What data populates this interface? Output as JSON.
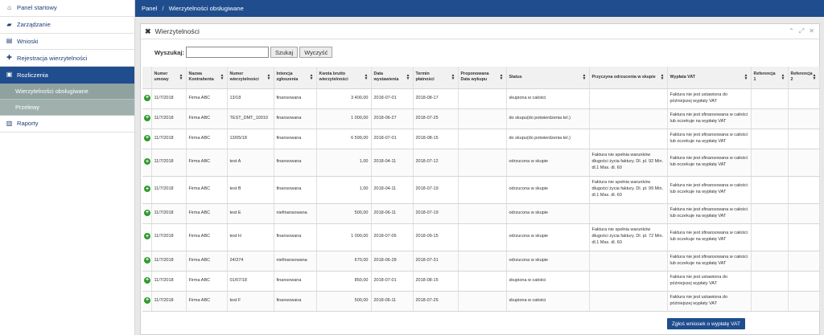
{
  "sidebar": {
    "items": [
      {
        "label": "Panel startowy",
        "icon": "home-icon",
        "glyph": "⌂"
      },
      {
        "label": "Zarządzanie",
        "icon": "briefcase-icon",
        "glyph": "▰"
      },
      {
        "label": "Wnioski",
        "icon": "document-icon",
        "glyph": "▤"
      },
      {
        "label": "Rejestracja wierzytelności",
        "icon": "plus-icon",
        "glyph": "✚"
      },
      {
        "label": "Rozliczenia",
        "icon": "money-icon",
        "glyph": "▣"
      },
      {
        "label": "Raporty",
        "icon": "bar-chart-icon",
        "glyph": "▥"
      }
    ],
    "sub_items": [
      {
        "label": "Wierzytelności obsługiwane"
      },
      {
        "label": "Przelewy"
      }
    ]
  },
  "breadcrumb": {
    "home": "Panel",
    "separator": "/",
    "current": "Wierzytelności obsługiwane"
  },
  "panel": {
    "title": "Wierzytelności",
    "close_glyph": "✖",
    "tool_glyphs": [
      "⌃",
      "⤢",
      "✕"
    ]
  },
  "search": {
    "label": "Wyszukaj:",
    "value": "",
    "search_button": "Szukaj",
    "clear_button": "Wyczyść"
  },
  "table": {
    "headers": [
      "Numer umowy",
      "Nazwa Kontrahenta",
      "Numer wierzytelności",
      "Intencja zgłoszenia",
      "Kwota brutto wierzytelności",
      "Data wystawienia",
      "Termin płatności",
      "Proponowana Data wykupu",
      "Status",
      "Przyczyna odrzucenia w skupie",
      "Wypłata VAT",
      "Referencja 1",
      "Referencja 2"
    ],
    "rows": [
      [
        "11/7/2018",
        "Firma ABC",
        "13/18",
        "finansowana",
        "3 400,00",
        "2018-07-01",
        "2018-08-17",
        "",
        "skupiona w całości",
        "",
        "Faktura nie jest ustawiona do późniejszej wypłaty VAT",
        "",
        ""
      ],
      [
        "11/7/2018",
        "Firma ABC",
        "TEST_DMT_10010",
        "finansowana",
        "1 000,00",
        "2018-06-27",
        "2018-07-25",
        "",
        "do skupu(do potwierdzenia tel.)",
        "",
        "Faktura nie jest sfinansowana w całości lub oczekuje na wypłatę VAT",
        "",
        ""
      ],
      [
        "11/7/2018",
        "Firma ABC",
        "13/05/18",
        "finansowana",
        "6 599,00",
        "2018-07-01",
        "2018-08-15",
        "",
        "do skupu(do potwierdzenia tel.)",
        "",
        "Faktura nie jest sfinansowana w całości lub oczekuje na wypłatę VAT",
        "",
        ""
      ],
      [
        "11/7/2018",
        "Firma ABC",
        "test A",
        "finansowana",
        "1,00",
        "2018-04-11",
        "2018-07-12",
        "",
        "odrzucona w skupie",
        "Faktura nie spełnia warunków długości życia faktury. Dl. pl. 92 Min. dl.1 Max. dl. 60",
        "Faktura nie jest sfinansowana w całości lub oczekuje na wypłatę VAT",
        "",
        ""
      ],
      [
        "11/7/2018",
        "Firma ABC",
        "test B",
        "finansowana",
        "1,00",
        "2018-04-11",
        "2018-07-19",
        "",
        "odrzucona w skupie",
        "Faktura nie spełnia warunków długości życia faktury. Dl. pl. 99 Min. dl.1 Max. dl. 60",
        "Faktura nie jest sfinansowana w całości lub oczekuje na wypłatę VAT",
        "",
        ""
      ],
      [
        "11/7/2018",
        "Firma ABC",
        "test E",
        "niefinansowana",
        "500,00",
        "2018-06-11",
        "2018-07-19",
        "",
        "odrzucona w skupie",
        "",
        "Faktura nie jest sfinansowana w całości lub oczekuje na wypłatę VAT",
        "",
        ""
      ],
      [
        "11/7/2018",
        "Firma ABC",
        "test H",
        "finansowana",
        "1 000,00",
        "2018-07-05",
        "2018-09-15",
        "",
        "odrzucona w skupie",
        "Faktura nie spełnia warunków długości życia faktury. Dl. pl. 72 Min. dl.1 Max. dl. 60",
        "Faktura nie jest sfinansowana w całości lub oczekuje na wypłatę VAT",
        "",
        ""
      ],
      [
        "11/7/2018",
        "Firma ABC",
        "24/374",
        "niefinansowana",
        "670,00",
        "2018-06-28",
        "2018-07-31",
        "",
        "odrzucona w skupie",
        "",
        "Faktura nie jest sfinansowana w całości lub oczekuje na wypłatę VAT",
        "",
        ""
      ],
      [
        "11/7/2018",
        "Firma ABC",
        "01/07/18",
        "finansowana",
        "850,00",
        "2018-07-01",
        "2018-08-15",
        "",
        "skupiona w całości",
        "",
        "Faktura nie jest ustawiona do późniejszej wypłaty VAT",
        "",
        ""
      ],
      [
        "11/7/2018",
        "Firma ABC",
        "test F",
        "finansowana",
        "500,00",
        "2018-06-11",
        "2018-07-25",
        "",
        "skupiona w całości",
        "",
        "Faktura nie jest ustawiona do późniejszej wypłaty VAT",
        "",
        ""
      ]
    ],
    "row_action_glyph": "+",
    "sort_glyph": "▲▼"
  },
  "submit_button": "Zgłoś wniosek o wypłatę VAT",
  "colors": {
    "primary": "#1f4d8e",
    "submenu": "#9fb0ad",
    "add": "#2f9a2f"
  }
}
